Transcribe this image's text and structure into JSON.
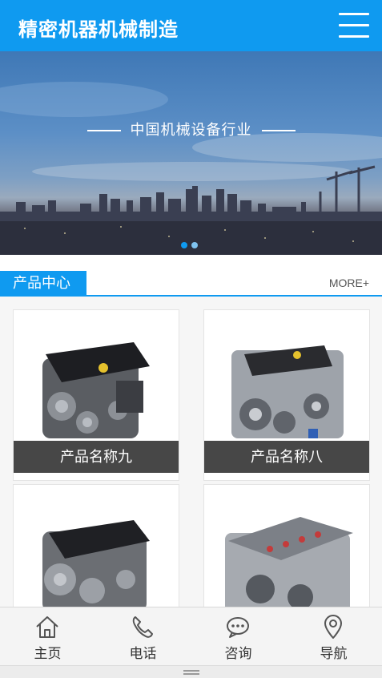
{
  "header": {
    "title": "精密机器机械制造"
  },
  "banner": {
    "caption": "中国机械设备行业",
    "active_slide": 2,
    "slide_count": 2
  },
  "section": {
    "label": "产品中心",
    "more": "MORE+"
  },
  "products": [
    {
      "name": "产品名称九"
    },
    {
      "name": "产品名称八"
    },
    {
      "name": ""
    },
    {
      "name": ""
    }
  ],
  "bottom_nav": [
    {
      "label": "主页",
      "icon": "home-icon"
    },
    {
      "label": "电话",
      "icon": "phone-icon"
    },
    {
      "label": "咨询",
      "icon": "chat-icon"
    },
    {
      "label": "导航",
      "icon": "location-pin-icon"
    }
  ],
  "colors": {
    "brand": "#0f9af0",
    "caption_bg": "#474747"
  }
}
